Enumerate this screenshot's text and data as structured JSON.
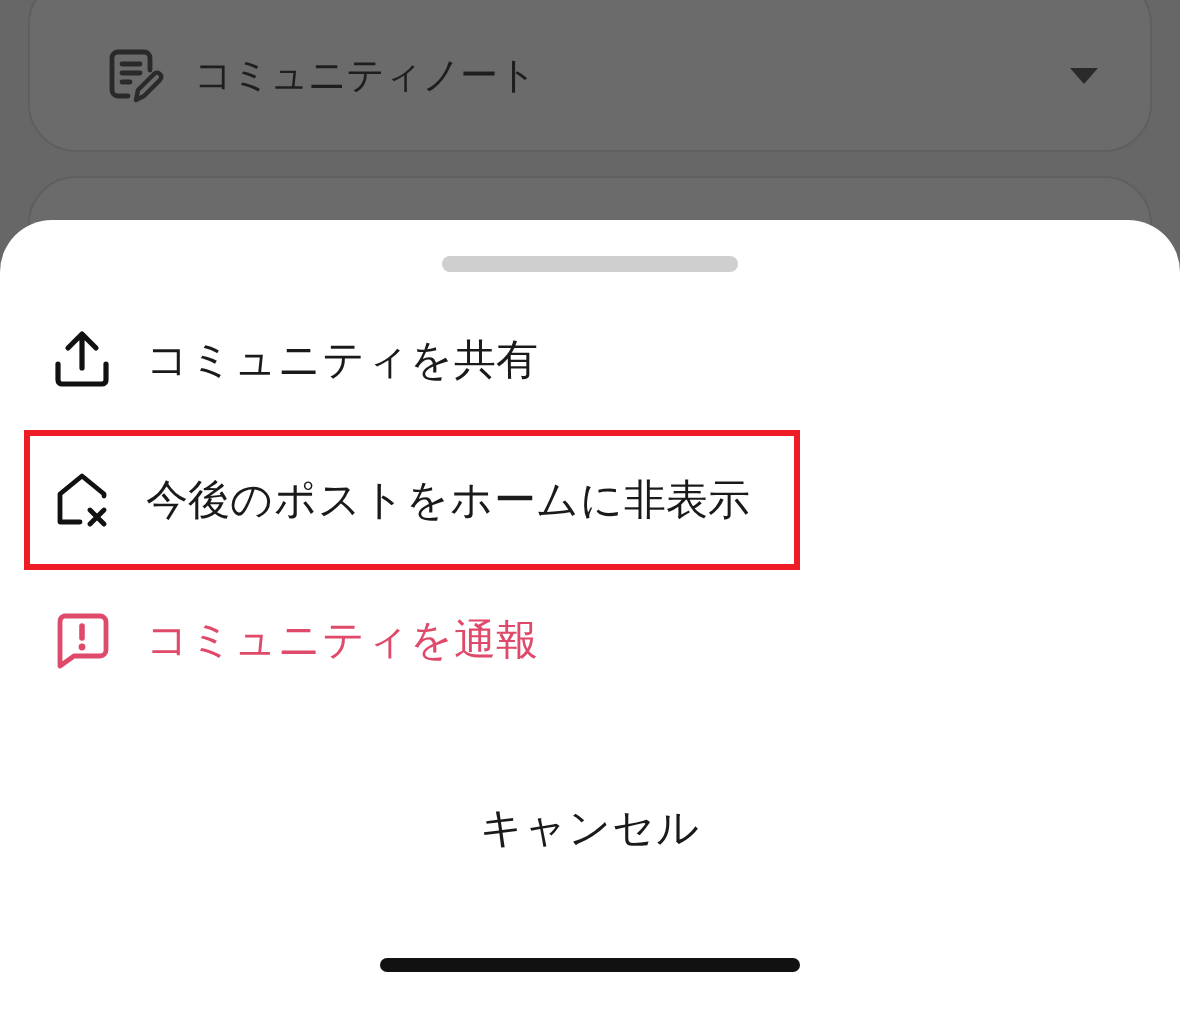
{
  "background_card": {
    "title": "コミュニティノート"
  },
  "sheet": {
    "items": [
      {
        "kind": "share",
        "label": "コミュニティを共有",
        "highlighted": false
      },
      {
        "kind": "hide",
        "label": "今後のポストをホームに非表示",
        "highlighted": true
      },
      {
        "kind": "report",
        "label": "コミュニティを通報",
        "highlighted": false
      }
    ],
    "cancel": "キャンセル"
  }
}
